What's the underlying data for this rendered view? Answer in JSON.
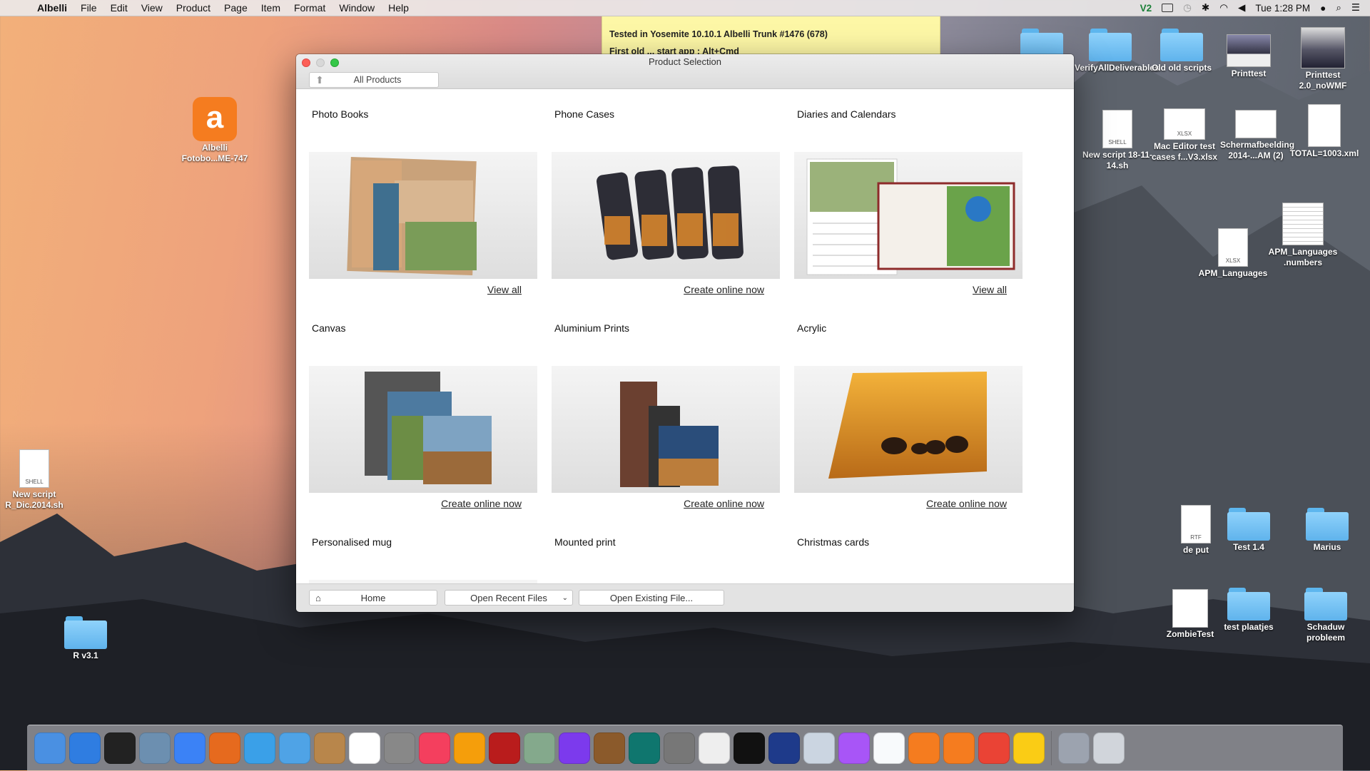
{
  "menubar": {
    "app": "Albelli",
    "items": [
      "File",
      "Edit",
      "View",
      "Product",
      "Page",
      "Item",
      "Format",
      "Window",
      "Help"
    ],
    "clock": "Tue 1:28 PM"
  },
  "sticky": {
    "line1": "Tested in Yosemite 10.10.1 Albelli Trunk #1476 (678)",
    "line2": "First old ... start app : Alt+Cmd"
  },
  "window": {
    "title": "Product Selection",
    "all_products": "All Products",
    "products": [
      {
        "title": "Photo Books",
        "link": "View all"
      },
      {
        "title": "Phone Cases",
        "link": "Create online now"
      },
      {
        "title": "Diaries and Calendars",
        "link": "View all"
      },
      {
        "title": "Canvas",
        "link": "Create online now"
      },
      {
        "title": "Aluminium Prints",
        "link": "Create online now"
      },
      {
        "title": "Acrylic",
        "link": "Create online now"
      },
      {
        "title": "Personalised mug",
        "link": ""
      },
      {
        "title": "Mounted print",
        "link": ""
      },
      {
        "title": "Christmas cards",
        "link": ""
      }
    ],
    "home_button": "Home",
    "recent_button": "Open Recent Files",
    "existing_button": "Open Existing File..."
  },
  "desktop": {
    "left_icons": [
      {
        "label": "Albelli Fotobo...ME-747",
        "kind": "app"
      },
      {
        "label": "New script R_Dic.2014.sh",
        "kind": "shell",
        "tag": "SHELL"
      },
      {
        "label": "R v3.1",
        "kind": "folder"
      }
    ],
    "right_icons": [
      {
        "label": "",
        "kind": "folder"
      },
      {
        "label": "VerifyAllDeliverables",
        "kind": "folder"
      },
      {
        "label": "Old old scripts",
        "kind": "folder"
      },
      {
        "label": "Printtest",
        "kind": "image"
      },
      {
        "label": "Printtest 2.0_noWMF",
        "kind": "image"
      },
      {
        "label": "New script 18-11-14.sh",
        "kind": "shell",
        "tag": "SHELL"
      },
      {
        "label": "Mac Editor test cases f...V3.xlsx",
        "kind": "doc",
        "tag": "XLSX"
      },
      {
        "label": "Schermafbeelding 2014-...AM (2)",
        "kind": "image"
      },
      {
        "label": "TOTAL=1003.xml",
        "kind": "doc",
        "tag": ""
      },
      {
        "label": "APM_Languages",
        "kind": "doc",
        "tag": "XLSX"
      },
      {
        "label": "APM_Languages .numbers",
        "kind": "image"
      },
      {
        "label": "de put",
        "kind": "doc",
        "tag": "RTF"
      },
      {
        "label": "Test 1.4",
        "kind": "folder"
      },
      {
        "label": "Marius",
        "kind": "folder"
      },
      {
        "label": "ZombieTest",
        "kind": "doc",
        "tag": ""
      },
      {
        "label": "test plaatjes",
        "kind": "folder"
      },
      {
        "label": "Schaduw probleem",
        "kind": "folder"
      }
    ]
  },
  "dock": {
    "colors": [
      "#4a90e2",
      "#2f7de1",
      "#222222",
      "#6c8fb0",
      "#3b82f6",
      "#e66a1e",
      "#3aa0e8",
      "#4fa3e6",
      "#b8864b",
      "#ffffff",
      "#888888",
      "#f43f5e",
      "#f59e0b",
      "#b91c1c",
      "#84a98c",
      "#7c3aed",
      "#8b5a2b",
      "#0f766e",
      "#777777",
      "#eeeeee",
      "#111111",
      "#1e3a8a",
      "#cbd5e1",
      "#a855f7",
      "#f8fafc",
      "#f57c1f",
      "#f57c1f",
      "#ea4335",
      "#facc15",
      "#9ca3af",
      "#d1d5db"
    ]
  }
}
